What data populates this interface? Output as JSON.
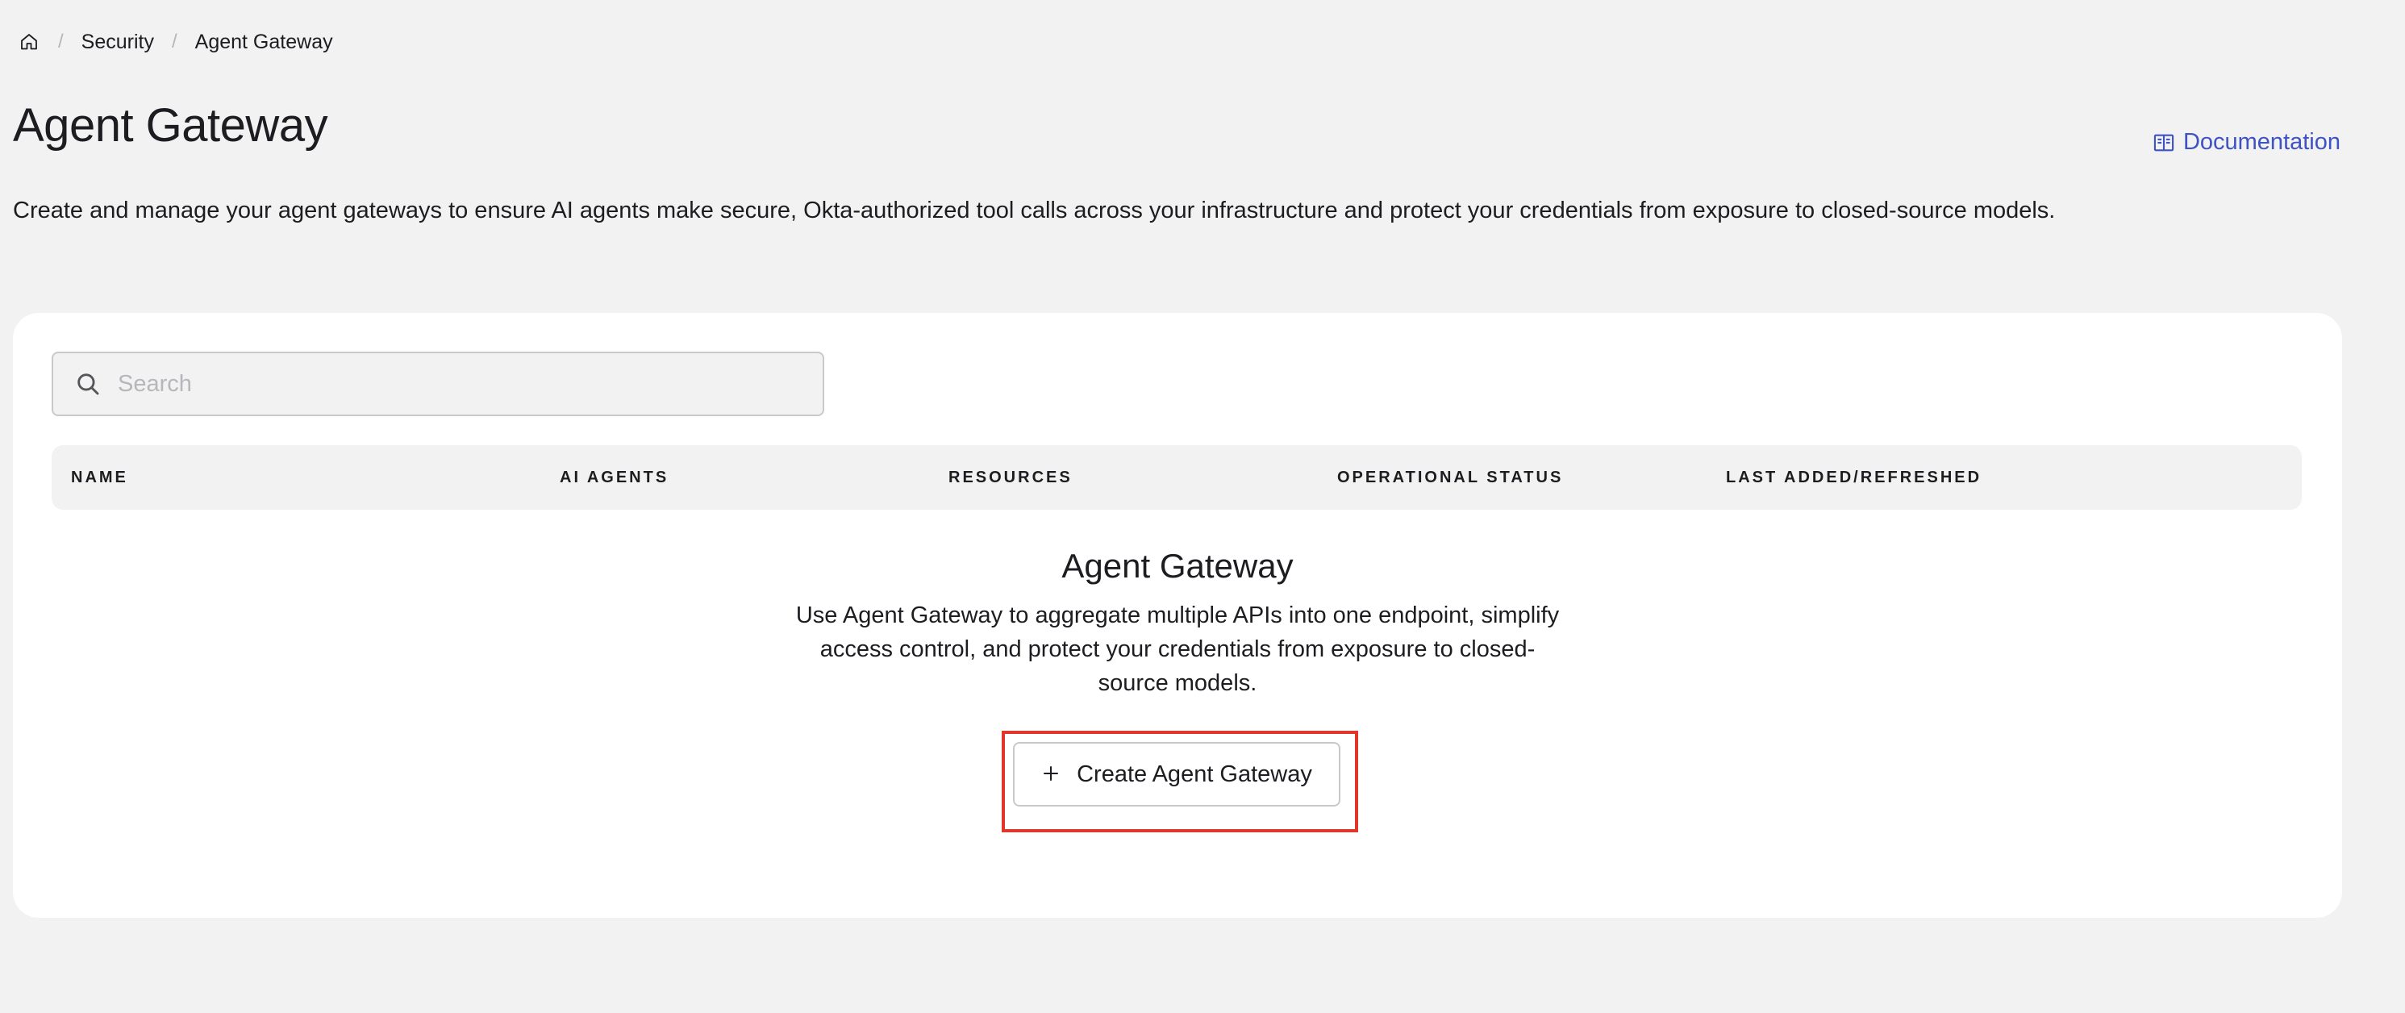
{
  "breadcrumb": {
    "home_icon": "home-icon",
    "items": [
      "Security",
      "Agent Gateway"
    ],
    "separator": "/"
  },
  "header": {
    "title": "Agent Gateway",
    "documentation_label": "Documentation",
    "documentation_icon": "book-icon",
    "description": "Create and manage your agent gateways to ensure AI agents make secure, Okta-authorized tool calls across your infrastructure and protect your credentials from exposure to closed-source models."
  },
  "search": {
    "placeholder": "Search",
    "value": "",
    "icon": "search-icon"
  },
  "table": {
    "columns": [
      "NAME",
      "AI AGENTS",
      "RESOURCES",
      "OPERATIONAL STATUS",
      "LAST ADDED/REFRESHED"
    ],
    "rows": []
  },
  "empty_state": {
    "title": "Agent Gateway",
    "description": "Use Agent Gateway to aggregate multiple APIs into one endpoint, simplify access control, and protect your credentials from exposure to closed-source models.",
    "create_button_label": "Create Agent Gateway",
    "create_button_icon": "plus-icon"
  },
  "colors": {
    "background": "#f2f2f2",
    "card": "#ffffff",
    "link": "#3e52c4",
    "highlight_border": "#e0372a",
    "text": "#1d1d21"
  }
}
